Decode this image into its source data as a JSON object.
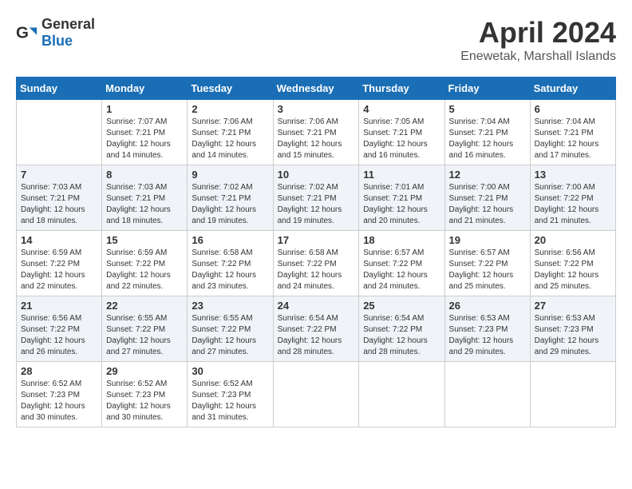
{
  "header": {
    "logo_general": "General",
    "logo_blue": "Blue",
    "month": "April 2024",
    "location": "Enewetak, Marshall Islands"
  },
  "days_of_week": [
    "Sunday",
    "Monday",
    "Tuesday",
    "Wednesday",
    "Thursday",
    "Friday",
    "Saturday"
  ],
  "weeks": [
    [
      {
        "day": "",
        "sunrise": "",
        "sunset": "",
        "daylight": ""
      },
      {
        "day": "1",
        "sunrise": "Sunrise: 7:07 AM",
        "sunset": "Sunset: 7:21 PM",
        "daylight": "Daylight: 12 hours and 14 minutes."
      },
      {
        "day": "2",
        "sunrise": "Sunrise: 7:06 AM",
        "sunset": "Sunset: 7:21 PM",
        "daylight": "Daylight: 12 hours and 14 minutes."
      },
      {
        "day": "3",
        "sunrise": "Sunrise: 7:06 AM",
        "sunset": "Sunset: 7:21 PM",
        "daylight": "Daylight: 12 hours and 15 minutes."
      },
      {
        "day": "4",
        "sunrise": "Sunrise: 7:05 AM",
        "sunset": "Sunset: 7:21 PM",
        "daylight": "Daylight: 12 hours and 16 minutes."
      },
      {
        "day": "5",
        "sunrise": "Sunrise: 7:04 AM",
        "sunset": "Sunset: 7:21 PM",
        "daylight": "Daylight: 12 hours and 16 minutes."
      },
      {
        "day": "6",
        "sunrise": "Sunrise: 7:04 AM",
        "sunset": "Sunset: 7:21 PM",
        "daylight": "Daylight: 12 hours and 17 minutes."
      }
    ],
    [
      {
        "day": "7",
        "sunrise": "Sunrise: 7:03 AM",
        "sunset": "Sunset: 7:21 PM",
        "daylight": "Daylight: 12 hours and 18 minutes."
      },
      {
        "day": "8",
        "sunrise": "Sunrise: 7:03 AM",
        "sunset": "Sunset: 7:21 PM",
        "daylight": "Daylight: 12 hours and 18 minutes."
      },
      {
        "day": "9",
        "sunrise": "Sunrise: 7:02 AM",
        "sunset": "Sunset: 7:21 PM",
        "daylight": "Daylight: 12 hours and 19 minutes."
      },
      {
        "day": "10",
        "sunrise": "Sunrise: 7:02 AM",
        "sunset": "Sunset: 7:21 PM",
        "daylight": "Daylight: 12 hours and 19 minutes."
      },
      {
        "day": "11",
        "sunrise": "Sunrise: 7:01 AM",
        "sunset": "Sunset: 7:21 PM",
        "daylight": "Daylight: 12 hours and 20 minutes."
      },
      {
        "day": "12",
        "sunrise": "Sunrise: 7:00 AM",
        "sunset": "Sunset: 7:21 PM",
        "daylight": "Daylight: 12 hours and 21 minutes."
      },
      {
        "day": "13",
        "sunrise": "Sunrise: 7:00 AM",
        "sunset": "Sunset: 7:22 PM",
        "daylight": "Daylight: 12 hours and 21 minutes."
      }
    ],
    [
      {
        "day": "14",
        "sunrise": "Sunrise: 6:59 AM",
        "sunset": "Sunset: 7:22 PM",
        "daylight": "Daylight: 12 hours and 22 minutes."
      },
      {
        "day": "15",
        "sunrise": "Sunrise: 6:59 AM",
        "sunset": "Sunset: 7:22 PM",
        "daylight": "Daylight: 12 hours and 22 minutes."
      },
      {
        "day": "16",
        "sunrise": "Sunrise: 6:58 AM",
        "sunset": "Sunset: 7:22 PM",
        "daylight": "Daylight: 12 hours and 23 minutes."
      },
      {
        "day": "17",
        "sunrise": "Sunrise: 6:58 AM",
        "sunset": "Sunset: 7:22 PM",
        "daylight": "Daylight: 12 hours and 24 minutes."
      },
      {
        "day": "18",
        "sunrise": "Sunrise: 6:57 AM",
        "sunset": "Sunset: 7:22 PM",
        "daylight": "Daylight: 12 hours and 24 minutes."
      },
      {
        "day": "19",
        "sunrise": "Sunrise: 6:57 AM",
        "sunset": "Sunset: 7:22 PM",
        "daylight": "Daylight: 12 hours and 25 minutes."
      },
      {
        "day": "20",
        "sunrise": "Sunrise: 6:56 AM",
        "sunset": "Sunset: 7:22 PM",
        "daylight": "Daylight: 12 hours and 25 minutes."
      }
    ],
    [
      {
        "day": "21",
        "sunrise": "Sunrise: 6:56 AM",
        "sunset": "Sunset: 7:22 PM",
        "daylight": "Daylight: 12 hours and 26 minutes."
      },
      {
        "day": "22",
        "sunrise": "Sunrise: 6:55 AM",
        "sunset": "Sunset: 7:22 PM",
        "daylight": "Daylight: 12 hours and 27 minutes."
      },
      {
        "day": "23",
        "sunrise": "Sunrise: 6:55 AM",
        "sunset": "Sunset: 7:22 PM",
        "daylight": "Daylight: 12 hours and 27 minutes."
      },
      {
        "day": "24",
        "sunrise": "Sunrise: 6:54 AM",
        "sunset": "Sunset: 7:22 PM",
        "daylight": "Daylight: 12 hours and 28 minutes."
      },
      {
        "day": "25",
        "sunrise": "Sunrise: 6:54 AM",
        "sunset": "Sunset: 7:22 PM",
        "daylight": "Daylight: 12 hours and 28 minutes."
      },
      {
        "day": "26",
        "sunrise": "Sunrise: 6:53 AM",
        "sunset": "Sunset: 7:23 PM",
        "daylight": "Daylight: 12 hours and 29 minutes."
      },
      {
        "day": "27",
        "sunrise": "Sunrise: 6:53 AM",
        "sunset": "Sunset: 7:23 PM",
        "daylight": "Daylight: 12 hours and 29 minutes."
      }
    ],
    [
      {
        "day": "28",
        "sunrise": "Sunrise: 6:52 AM",
        "sunset": "Sunset: 7:23 PM",
        "daylight": "Daylight: 12 hours and 30 minutes."
      },
      {
        "day": "29",
        "sunrise": "Sunrise: 6:52 AM",
        "sunset": "Sunset: 7:23 PM",
        "daylight": "Daylight: 12 hours and 30 minutes."
      },
      {
        "day": "30",
        "sunrise": "Sunrise: 6:52 AM",
        "sunset": "Sunset: 7:23 PM",
        "daylight": "Daylight: 12 hours and 31 minutes."
      },
      {
        "day": "",
        "sunrise": "",
        "sunset": "",
        "daylight": ""
      },
      {
        "day": "",
        "sunrise": "",
        "sunset": "",
        "daylight": ""
      },
      {
        "day": "",
        "sunrise": "",
        "sunset": "",
        "daylight": ""
      },
      {
        "day": "",
        "sunrise": "",
        "sunset": "",
        "daylight": ""
      }
    ]
  ]
}
